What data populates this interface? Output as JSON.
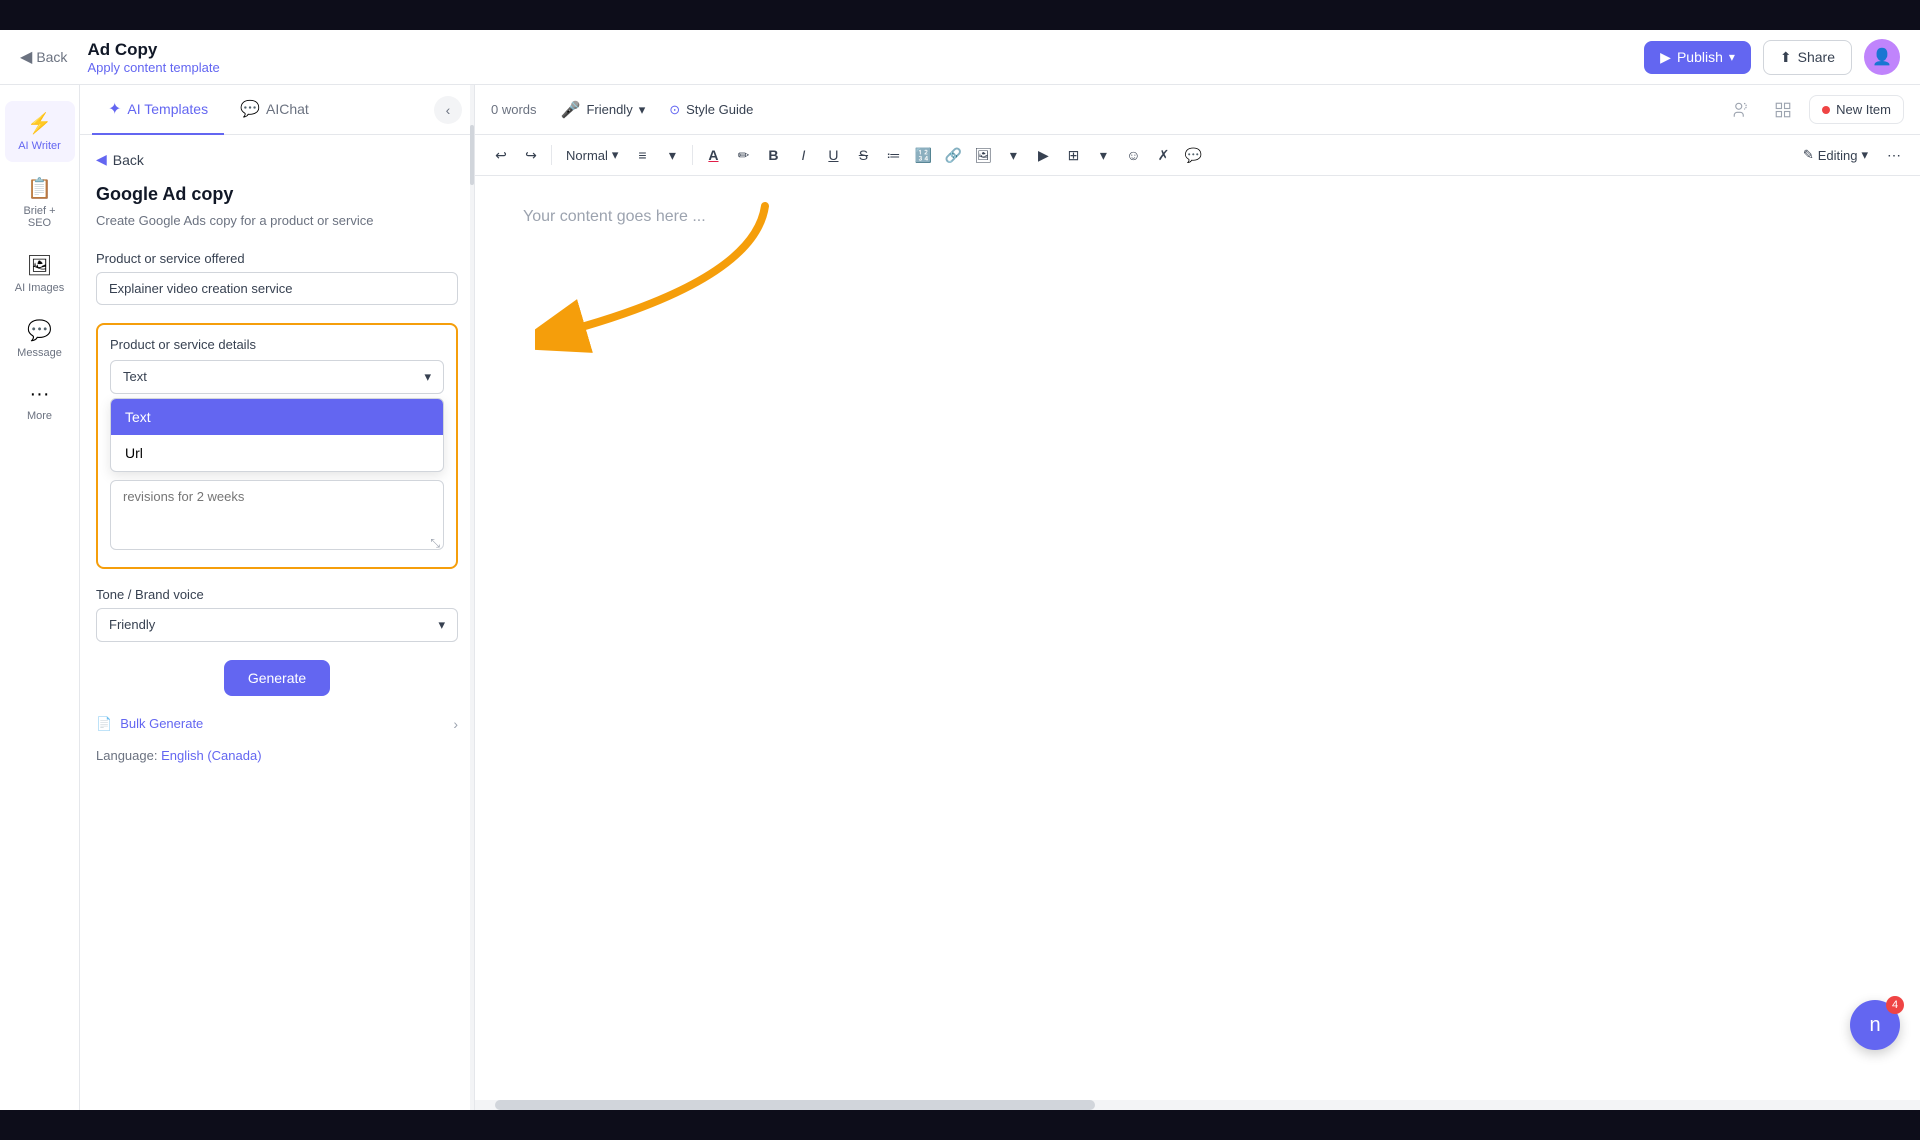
{
  "topbar": {
    "back_label": "Back",
    "title": "Ad Copy",
    "subtitle": "Apply content template",
    "publish_label": "Publish",
    "share_label": "Share"
  },
  "sidebar": {
    "items": [
      {
        "id": "ai-writer",
        "icon": "⚡",
        "label": "AI Writer",
        "active": true
      },
      {
        "id": "brief-seo",
        "icon": "📋",
        "label": "Brief + SEO",
        "active": false
      },
      {
        "id": "ai-images",
        "icon": "🖼",
        "label": "AI Images",
        "active": false
      },
      {
        "id": "message",
        "icon": "💬",
        "label": "Message",
        "active": false
      },
      {
        "id": "more",
        "icon": "···",
        "label": "More",
        "active": false
      }
    ]
  },
  "panel": {
    "tabs": [
      {
        "id": "ai-templates",
        "icon": "✦",
        "label": "AI Templates",
        "active": true
      },
      {
        "id": "aichat",
        "icon": "💬",
        "label": "AIChat",
        "active": false
      }
    ],
    "back_label": "Back",
    "template_title": "Google Ad copy",
    "template_desc": "Create Google Ads copy for a product or service",
    "form": {
      "product_label": "Product or service offered",
      "product_placeholder": "Explainer video creation service",
      "details_label": "Product or service details",
      "dropdown_current": "Text",
      "dropdown_options": [
        {
          "id": "text",
          "label": "Text",
          "selected": true
        },
        {
          "id": "url",
          "label": "Url",
          "selected": false
        }
      ],
      "textarea_placeholder": "revisions for 2 weeks",
      "tone_label": "Tone / Brand voice",
      "tone_value": "Friendly"
    },
    "generate_label": "Generate",
    "bulk_generate_label": "Bulk Generate",
    "language_label": "Language:",
    "language_value": "English (Canada)"
  },
  "editor": {
    "word_count": "0 words",
    "tone": "Friendly",
    "style_guide": "Style Guide",
    "style_label": "Normal",
    "editing_label": "Editing",
    "placeholder": "Your content goes here ...",
    "new_item_label": "New Item"
  }
}
